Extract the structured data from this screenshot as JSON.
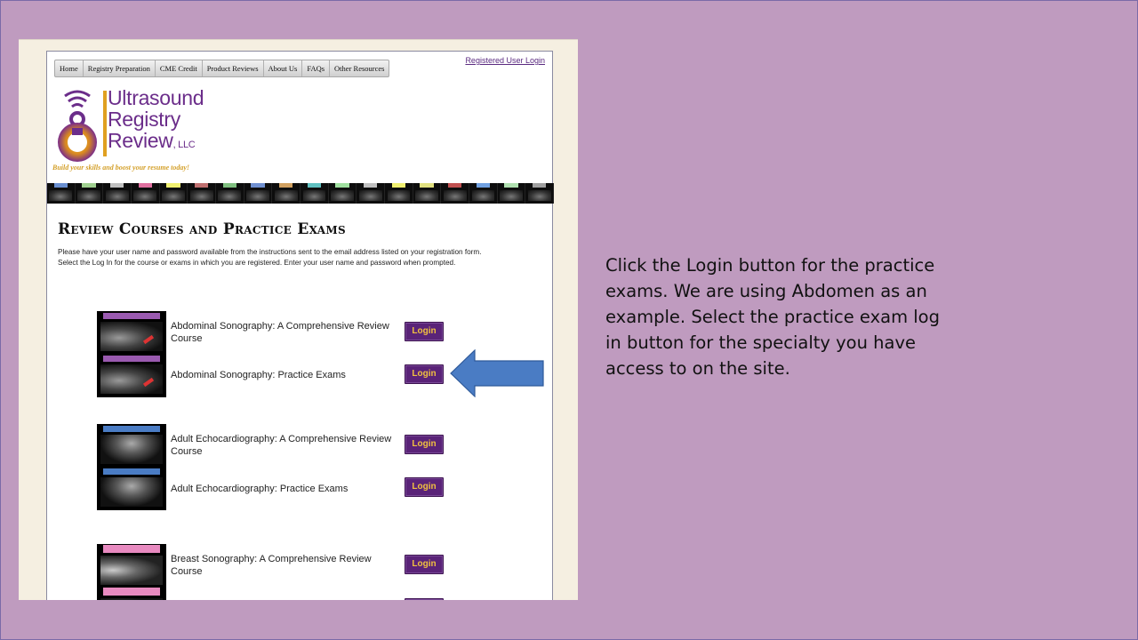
{
  "nav": {
    "items": [
      "Home",
      "Registry Preparation",
      "CME Credit",
      "Product Reviews",
      "About Us",
      "FAQs",
      "Other Resources"
    ],
    "registered_login": "Registered User Login"
  },
  "logo": {
    "line1": "Ultrasound",
    "line2": "Registry",
    "line3": "Review",
    "suffix": ", LLC",
    "tagline": "Build your skills and boost your resume today!"
  },
  "page": {
    "title": "Review Courses and Practice Exams",
    "intro_line1": "Please have your user name and password available from the instructions sent to the email address listed on your registration form.",
    "intro_line2": "Select the Log In for the course or exams in which you are registered.  Enter your user name and password when prompted."
  },
  "courses": [
    {
      "review": "Abdominal Sonography: A Comprehensive Review Course",
      "exams": "Abdominal Sonography: Practice Exams"
    },
    {
      "review": "Adult Echocardiography: A Comprehensive Review Course",
      "exams": "Adult Echocardiography: Practice Exams"
    },
    {
      "review": "Breast Sonography: A Comprehensive Review Course",
      "exams": ""
    }
  ],
  "login_label": "Login",
  "caption": "Click the Login button for the practice exams. We are using Abdomen as an example. Select the practice exam log in button for the specialty you have access to on the site.",
  "colors": {
    "background": "#bf9bbf",
    "login_button": "#5a2378",
    "login_text": "#f0c040",
    "arrow": "#4a7cc4",
    "logo_purple": "#6b2d8a",
    "logo_gold": "#e0a020"
  }
}
